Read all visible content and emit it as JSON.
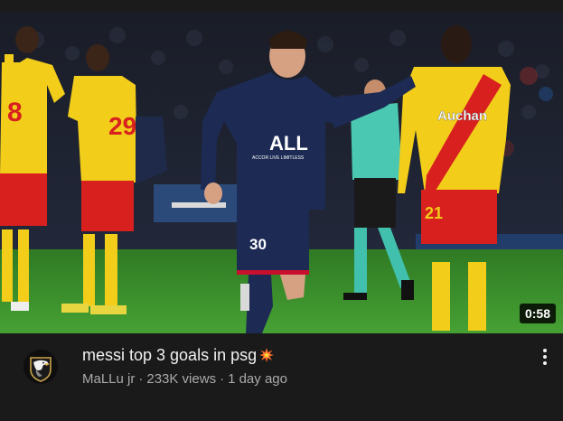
{
  "video": {
    "duration": "0:58",
    "title": "messi top 3 goals in psg",
    "title_emoji": "collision-burst-icon",
    "channel": "MaLLu jr",
    "views": "233K views",
    "age": "1 day ago",
    "separator": "·",
    "thumbnail": {
      "player_center_jersey": "30",
      "player_center_sponsor": "ALL",
      "player_center_sponsor_sub": "ACCOR LIVE LIMITLESS",
      "player_left_1_number": "8",
      "player_left_2_number": "29",
      "player_right_number": "21",
      "player_right_sponsor": "Auchan"
    }
  },
  "icons": {
    "avatar": "eagle-icon",
    "menu": "more-vertical-icon"
  },
  "colors": {
    "background": "#141414",
    "meta_background": "#1a1a1a",
    "title": "#f1f1f1",
    "byline": "#aaaaaa",
    "psg_navy": "#1d2b54",
    "lens_yellow": "#f2cd1a",
    "lens_red": "#d8201f",
    "pitch_green": "#3b8b2c"
  }
}
